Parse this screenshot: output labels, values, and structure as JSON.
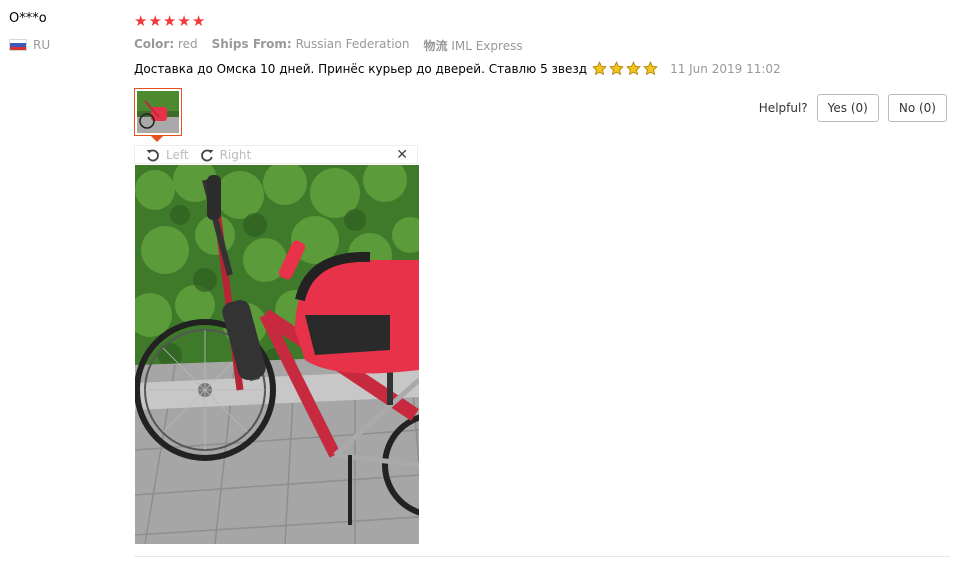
{
  "user": {
    "name": "O***o",
    "country": "RU"
  },
  "review": {
    "rating": 5,
    "stars": [
      "★",
      "★",
      "★",
      "★",
      "★"
    ],
    "color_label": "Color:",
    "color_value": "red",
    "ships_label": "Ships From:",
    "ships_value": "Russian Federation",
    "logistics_label": "物流",
    "logistics_value": "IML Express",
    "text": "Доставка до Омска 10 дней. Принёс курьер до дверей. Ставлю 5 звезд",
    "emoji_star_count": 4,
    "date": "11 Jun 2019 11:02"
  },
  "helpful": {
    "label": "Helpful?",
    "yes_label": "Yes (0)",
    "no_label": "No (0)"
  },
  "viewer": {
    "rotate_left_label": "Left",
    "rotate_right_label": "Right",
    "close_label": "✕"
  },
  "colors": {
    "star_red": "#ef3b3b",
    "accent_orange": "#e5521d",
    "muted_text": "#999999",
    "seat_red": "#e8324a"
  }
}
